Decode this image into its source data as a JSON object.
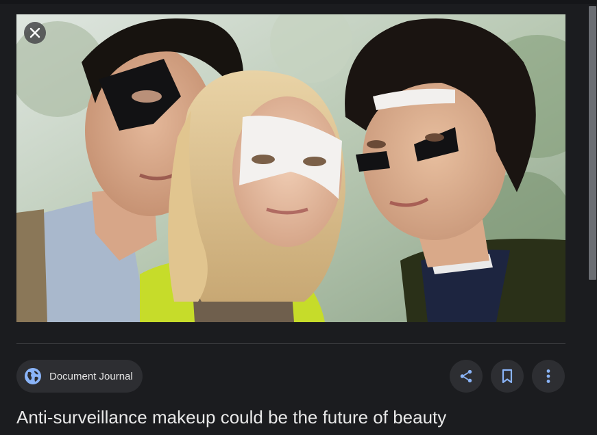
{
  "source": {
    "name": "Document Journal",
    "icon": "globe-icon"
  },
  "title": "Anti-surveillance makeup could be the future of beauty",
  "actions": {
    "close_icon": "close-icon",
    "share_icon": "share-icon",
    "save_icon": "bookmark-icon",
    "more_icon": "more-vert-icon"
  },
  "colors": {
    "background": "#1b1c1f",
    "chip": "#2d2e32",
    "accent": "#8ab4f8",
    "text": "#e3e3e3"
  }
}
